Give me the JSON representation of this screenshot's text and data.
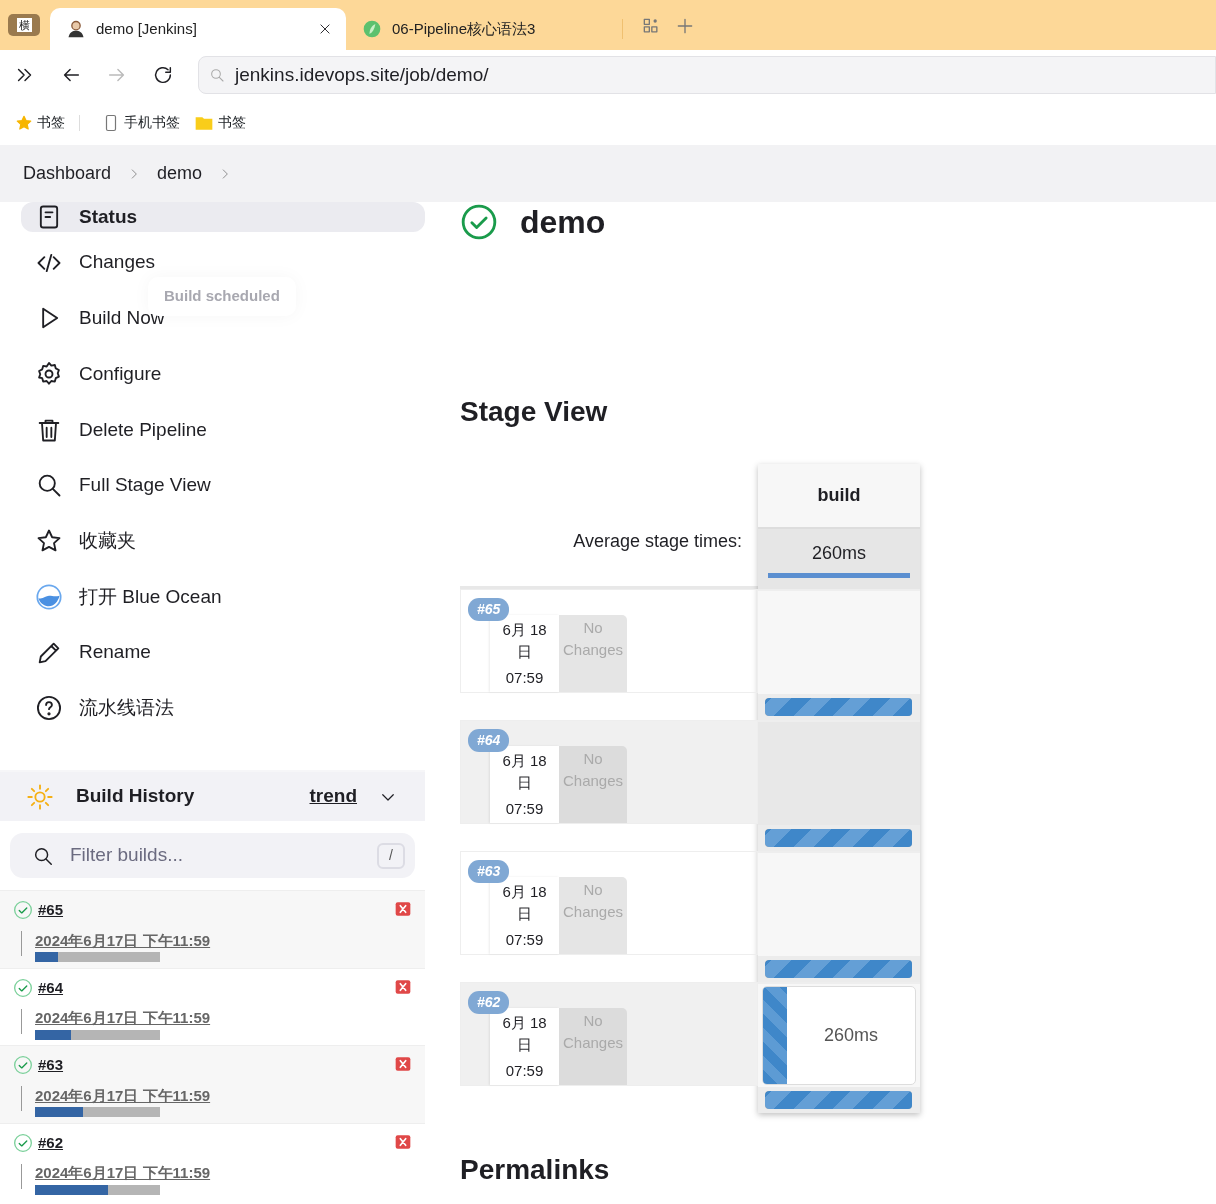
{
  "browser": {
    "side_badge": "横",
    "tabs": [
      {
        "title": "demo [Jenkins]",
        "selected": true
      },
      {
        "title": "06-Pipeline核心语法3",
        "selected": false
      }
    ],
    "url": "jenkins.idevops.site/job/demo/",
    "bookmarks": [
      {
        "label": "书签",
        "kind": "star"
      },
      {
        "label": "手机书签",
        "kind": "phone"
      },
      {
        "label": "书签",
        "kind": "folder"
      }
    ]
  },
  "breadcrumb": [
    "Dashboard",
    "demo"
  ],
  "toast": "Build scheduled",
  "sidebar": {
    "items": [
      {
        "label": "Status",
        "selected": true
      },
      {
        "label": "Changes",
        "selected": false
      },
      {
        "label": "Build Now",
        "selected": false
      },
      {
        "label": "Configure",
        "selected": false
      },
      {
        "label": "Delete Pipeline",
        "selected": false
      },
      {
        "label": "Full Stage View",
        "selected": false
      },
      {
        "label": "收藏夹",
        "selected": false
      },
      {
        "label": "打开 Blue Ocean",
        "selected": false
      },
      {
        "label": "Rename",
        "selected": false
      },
      {
        "label": "流水线语法",
        "selected": false
      }
    ]
  },
  "build_history": {
    "title": "Build History",
    "trend": "trend",
    "filter": {
      "placeholder": "Filter builds...",
      "shortcut": "/"
    },
    "builds": [
      {
        "number": "#65",
        "time": "2024年6月17日 下午11:59",
        "level": 0.18
      },
      {
        "number": "#64",
        "time": "2024年6月17日 下午11:59",
        "level": 0.29
      },
      {
        "number": "#63",
        "time": "2024年6月17日 下午11:59",
        "level": 0.38
      },
      {
        "number": "#62",
        "time": "2024年6月17日 下午11:59",
        "level": 0.58
      }
    ]
  },
  "job": {
    "title": "demo"
  },
  "stage_view": {
    "title": "Stage View",
    "stages": [
      "build"
    ],
    "average_label": "Average stage times:",
    "averages": [
      "260ms"
    ],
    "runs": [
      {
        "badge": "#65",
        "date": "6月 18 日",
        "time": "07:59",
        "changes": "No Changes",
        "level": 1
      },
      {
        "badge": "#64",
        "date": "6月 18 日",
        "time": "07:59",
        "changes": "No Changes",
        "level": 1
      },
      {
        "badge": "#63",
        "date": "6月 18 日",
        "time": "07:59",
        "changes": "No Changes",
        "level": 1
      },
      {
        "badge": "#62",
        "date": "6月 18 日",
        "time": "07:59",
        "changes": "No Changes",
        "level": 1,
        "duration": "260ms"
      }
    ]
  },
  "permalinks_title": "Permalinks"
}
